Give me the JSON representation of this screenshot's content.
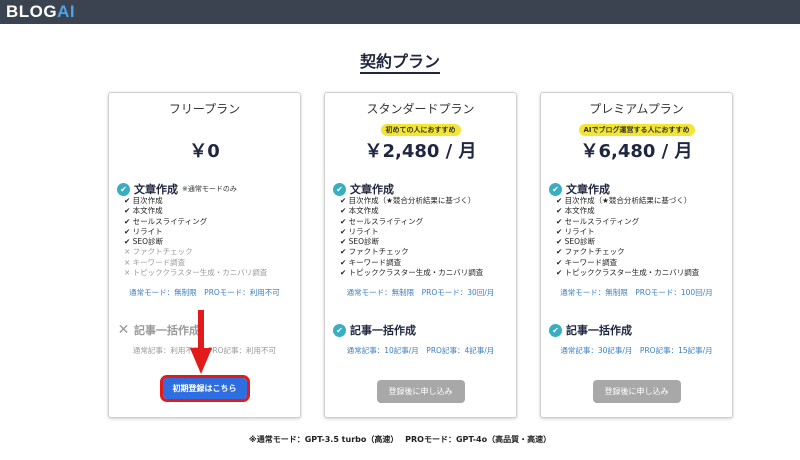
{
  "app": {
    "logo_main": "BLOG",
    "logo_accent": "AI"
  },
  "page": {
    "title": "契約プラン"
  },
  "plans": [
    {
      "name": "フリープラン",
      "badge": "",
      "price": "￥0",
      "section1": {
        "title": "文章作成",
        "note": "※通常モードのみ"
      },
      "features": [
        "✔ 目次作成",
        "✔ 本文作成",
        "✔ セールスライティング",
        "✔ リライト",
        "✔ SEO診断"
      ],
      "disabled_features": [
        "× ファクトチェック",
        "× キーワード調査",
        "× トピッククラスター生成・カニバリ調査"
      ],
      "mode_line": "通常モード：無制限　PROモード：利用不可",
      "section2": {
        "title": "記事一括作成",
        "counts": "通常記事：利用不可　PRO記事：利用不可"
      },
      "button": "初期登録はこちら"
    },
    {
      "name": "スタンダードプラン",
      "badge": "初めての人におすすめ",
      "price": "￥2,480 / 月",
      "section1": {
        "title": "文章作成",
        "note": ""
      },
      "features": [
        "✔ 目次作成（★競合分析結果に基づく）",
        "✔ 本文作成",
        "✔ セールスライティング",
        "✔ リライト",
        "✔ SEO診断",
        "✔ ファクトチェック",
        "✔ キーワード調査",
        "✔ トピッククラスター生成・カニバリ調査"
      ],
      "disabled_features": [],
      "mode_line": "通常モード：無制限　PROモード：30回/月",
      "section2": {
        "title": "記事一括作成",
        "counts": "通常記事：10記事/月　PRO記事：4記事/月"
      },
      "button": "登録後に申し込み"
    },
    {
      "name": "プレミアムプラン",
      "badge": "AIでブログ運営する人におすすめ",
      "price": "￥6,480 / 月",
      "section1": {
        "title": "文章作成",
        "note": ""
      },
      "features": [
        "✔ 目次作成（★競合分析結果に基づく）",
        "✔ 本文作成",
        "✔ セールスライティング",
        "✔ リライト",
        "✔ SEO診断",
        "✔ ファクトチェック",
        "✔ キーワード調査",
        "✔ トピッククラスター生成・カニバリ調査"
      ],
      "disabled_features": [],
      "mode_line": "通常モード：無制限　PROモード：100回/月",
      "section2": {
        "title": "記事一括作成",
        "counts": "通常記事：30記事/月　PRO記事：15記事/月"
      },
      "button": "登録後に申し込み"
    }
  ],
  "footnote": "※通常モード：GPT-3.5 turbo（高速）　 PROモード：GPT-4o（高品質・高速）",
  "colors": {
    "topbar": "#3b4350",
    "accent": "#3aaec1",
    "primary_button": "#2f6ee0",
    "highlight": "#e21a1a",
    "badge": "#f2e533"
  },
  "icons": {
    "check": "check-circle-icon",
    "unavailable": "x-icon",
    "annotation": "red-arrow-icon"
  }
}
